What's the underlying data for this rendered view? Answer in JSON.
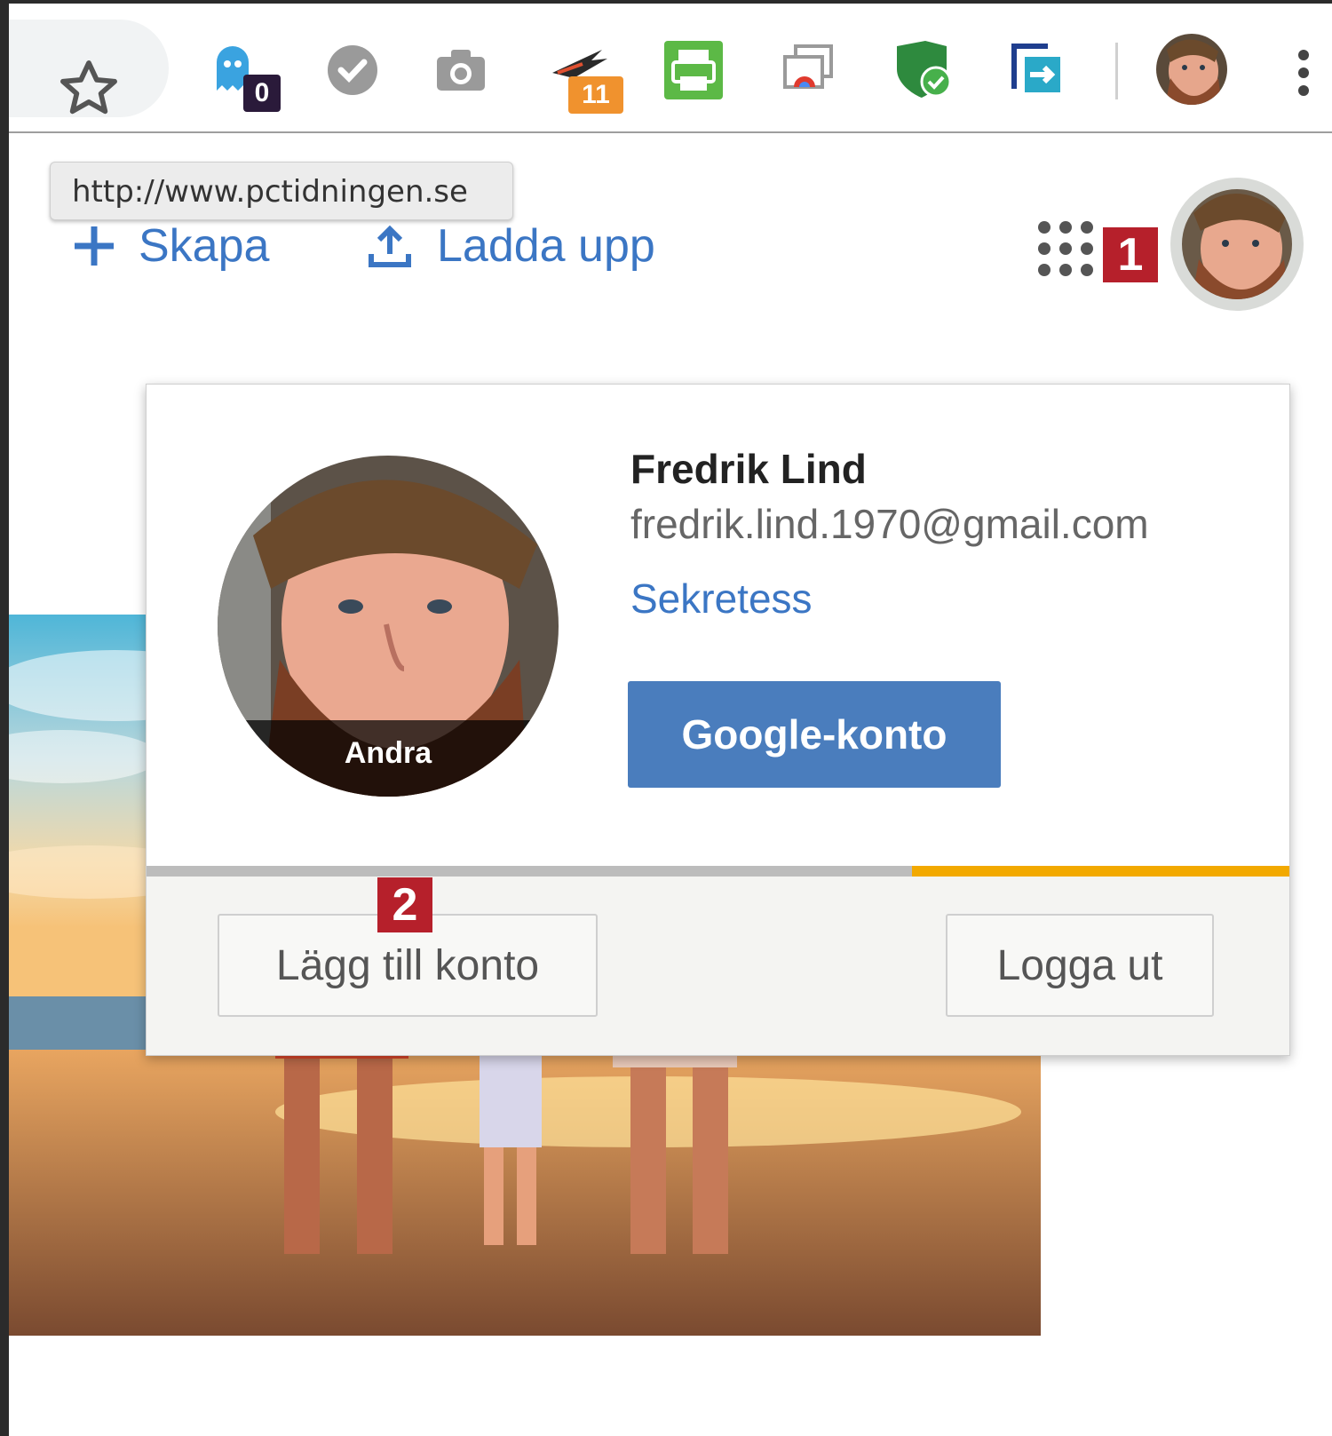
{
  "toolbar": {
    "badge_ghostery": "0",
    "badge_extension": "11",
    "bookmark_icon": "star-icon",
    "menu_icon": "kebab-menu-icon"
  },
  "tooltip": {
    "url": "http://www.pctidningen.se"
  },
  "header": {
    "create_label": "Skapa",
    "upload_label": "Ladda upp"
  },
  "markers": {
    "one": "1",
    "two": "2"
  },
  "account_popup": {
    "name": "Fredrik Lind",
    "email": "fredrik.lind.1970@gmail.com",
    "privacy_link": "Sekretess",
    "change_photo_label": "Andra",
    "google_account_button": "Google-konto",
    "add_account_button": "Lägg till konto",
    "sign_out_button": "Logga ut",
    "loading_progress": 0.33
  },
  "colors": {
    "link_blue": "#3b76c4",
    "button_blue": "#4a7dbd",
    "marker_red": "#b6202b",
    "progress_orange": "#f2a900"
  }
}
